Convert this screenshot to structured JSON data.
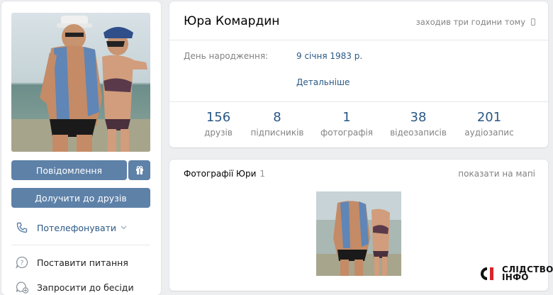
{
  "sidebar": {
    "message_button": "Повідомлення",
    "add_friend_button": "Долучити до друзів",
    "call_action": "Потелефонувати",
    "ask_question_action": "Поставити питання",
    "invite_chat_action": "Запросити до бесіди"
  },
  "profile": {
    "name": "Юра Комардин",
    "last_seen": "заходив три години тому",
    "birthday_label": "День народження:",
    "birthday_value": "9 січня 1983 р.",
    "details_link": "Детальніше",
    "counters": [
      {
        "num": "156",
        "label": "друзів"
      },
      {
        "num": "8",
        "label": "підписників"
      },
      {
        "num": "1",
        "label": "фотографія"
      },
      {
        "num": "38",
        "label": "відеозаписів"
      },
      {
        "num": "201",
        "label": "аудіозапис"
      }
    ]
  },
  "photos": {
    "title": "Фотографії Юри",
    "count": "1",
    "map_link": "показати на мапі"
  },
  "watermark": {
    "line1": "СЛІДСТВО",
    "line2": "ІНФО"
  },
  "colors": {
    "accent": "#5e81a8",
    "link": "#2a5885",
    "background": "#edeef0",
    "muted": "#828282"
  },
  "icons": [
    "gift-icon",
    "phone-icon",
    "chevron-down-icon",
    "question-icon",
    "add-chat-icon",
    "mobile-icon"
  ]
}
